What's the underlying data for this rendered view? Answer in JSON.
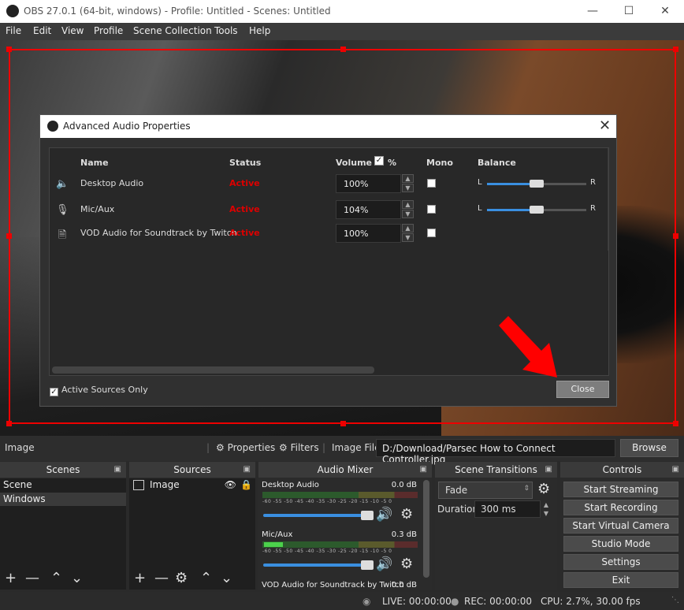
{
  "window": {
    "title": "OBS 27.0.1 (64-bit, windows) - Profile: Untitled - Scenes: Untitled"
  },
  "menu": [
    "File",
    "Edit",
    "View",
    "Profile",
    "Scene Collection",
    "Tools",
    "Help"
  ],
  "dialog": {
    "title": "Advanced Audio Properties",
    "headers": {
      "name": "Name",
      "status": "Status",
      "volume": "Volume",
      "percent": "%",
      "mono": "Mono",
      "balance": "Balance"
    },
    "rows": [
      {
        "icon": "speaker-icon",
        "name": "Desktop Audio",
        "status": "Active",
        "volume": "100%",
        "balance": 0.5,
        "show_balance": true
      },
      {
        "icon": "microphone-icon",
        "name": "Mic/Aux",
        "status": "Active",
        "volume": "104%",
        "balance": 0.5,
        "show_balance": true
      },
      {
        "icon": "file-icon",
        "name": "VOD Audio for Soundtrack by Twitch",
        "status": "Active",
        "volume": "100%",
        "show_balance": false
      }
    ],
    "balance_left": "L",
    "balance_right": "R",
    "active_sources_only": "Active Sources Only",
    "close_label": "Close"
  },
  "propbar": {
    "source": "Image",
    "properties": "Properties",
    "filters": "Filters",
    "file_label": "Image File",
    "file_path": "D:/Download/Parsec How to Connect Controller.jpg",
    "browse": "Browse"
  },
  "docks": {
    "scenes": {
      "title": "Scenes",
      "items": [
        "Scene",
        "Windows"
      ]
    },
    "sources": {
      "title": "Sources",
      "items": [
        "Image"
      ]
    },
    "mixer": {
      "title": "Audio Mixer",
      "channels": [
        {
          "name": "Desktop Audio",
          "db": "0.0 dB"
        },
        {
          "name": "Mic/Aux",
          "db": "0.3 dB"
        },
        {
          "name": "VOD Audio for Soundtrack by Twitch",
          "db": "0.0 dB"
        }
      ],
      "scale": "-60 -55 -50 -45 -40 -35 -30 -25 -20 -15 -10 -5 0"
    },
    "transitions": {
      "title": "Scene Transitions",
      "selected": "Fade",
      "duration_label": "Duration",
      "duration": "300 ms"
    },
    "controls": {
      "title": "Controls",
      "buttons": [
        "Start Streaming",
        "Start Recording",
        "Start Virtual Camera",
        "Studio Mode",
        "Settings",
        "Exit"
      ]
    }
  },
  "status": {
    "live": "LIVE: 00:00:00",
    "rec": "REC: 00:00:00",
    "cpu": "CPU: 2.7%, 30.00 fps"
  },
  "colors": {
    "selection": "#e00000",
    "active_status": "#dd0000",
    "accent": "#3a8fe0",
    "arrow": "#ff0000"
  }
}
